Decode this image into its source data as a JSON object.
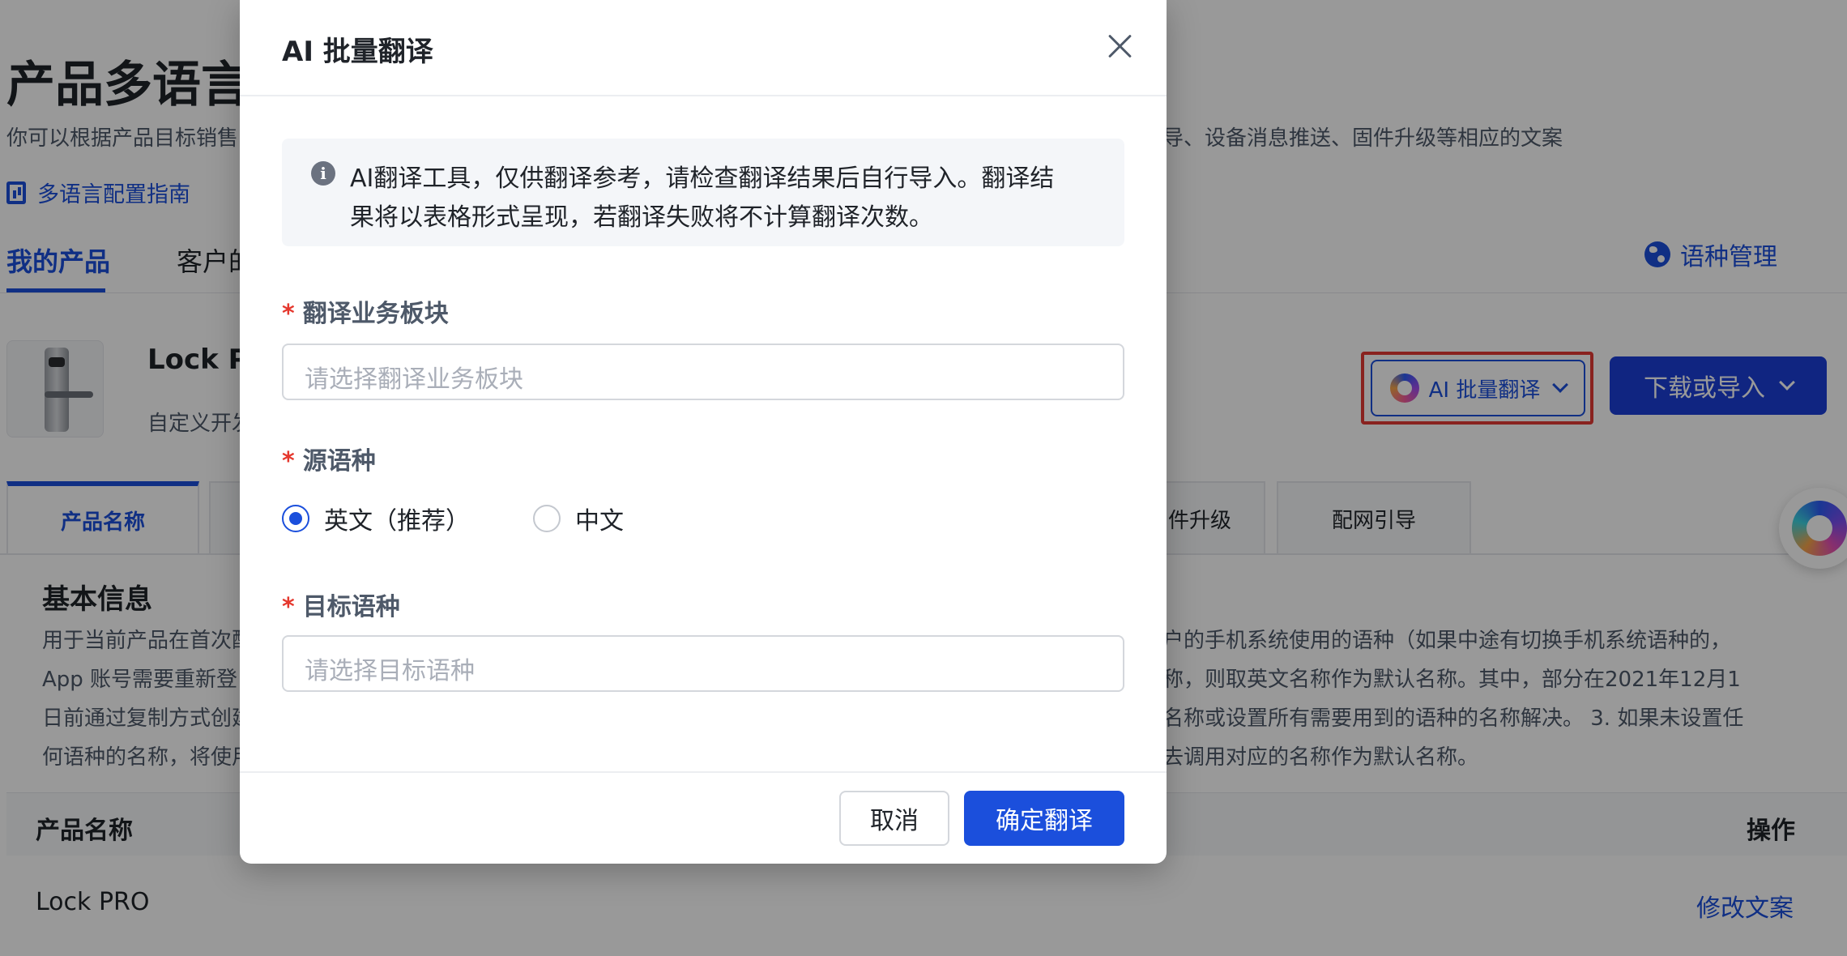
{
  "page": {
    "title": "产品多语言",
    "description": "你可以根据产品目标销售",
    "description_tail": "导、设备消息推送、固件升级等相应的文案",
    "guide_link": "多语言配置指南",
    "tabs": {
      "mine": "我的产品",
      "customer": "客户的"
    },
    "language_management": "语种管理"
  },
  "product": {
    "name": "Lock PI",
    "subtitle": "自定义开发",
    "ai_button": "AI 批量翻译",
    "download_button": "下载或导入"
  },
  "section_tabs": [
    {
      "label": "产品名称",
      "active": true
    },
    {
      "label": "",
      "active": false
    },
    {
      "label": "件升级",
      "active": false
    },
    {
      "label": "配网引导",
      "active": false
    }
  ],
  "basic_info": {
    "title": "基本信息",
    "left_lines": [
      "用于当前产品在首次配",
      "App 账号需要重新登",
      "日前通过复制方式创建",
      "何语种的名称，将使用"
    ],
    "right_lines": [
      "户的手机系统使用的语种（如果中途有切换手机系统语种的，",
      "称，则取英文名称作为默认名称。其中，部分在2021年12月1",
      "名称或设置所有需要用到的语种的名称解决。 3. 如果未设置任",
      "去调用对应的名称作为默认名称。"
    ]
  },
  "table": {
    "headers": {
      "name": "产品名称",
      "operation": "操作"
    },
    "rows": [
      {
        "name": "Lock PRO",
        "operation": "修改文案"
      }
    ]
  },
  "modal": {
    "title": "AI 批量翻译",
    "alert_lines": [
      "AI翻译工具，仅供翻译参考，请检查翻译结果后自行导入。翻译结",
      "果将以表格形式呈现，若翻译失败将不计算翻译次数。"
    ],
    "required_mark": "*",
    "business_label": "翻译业务板块",
    "business_placeholder": "请选择翻译业务板块",
    "source_label": "源语种",
    "source_options": [
      {
        "label": "英文（推荐）",
        "checked": true
      },
      {
        "label": "中文",
        "checked": false
      }
    ],
    "target_label": "目标语种",
    "target_placeholder": "请选择目标语种",
    "cancel": "取消",
    "confirm": "确定翻译"
  },
  "icons": {
    "guide": "chart-doc-icon",
    "globe": "globe-icon",
    "ai": "ai-orb-icon",
    "close": "close-icon",
    "info": "info-icon"
  },
  "colors": {
    "primary": "#1b4fdc",
    "danger": "#e5382e",
    "highlight_border": "#e53935"
  }
}
